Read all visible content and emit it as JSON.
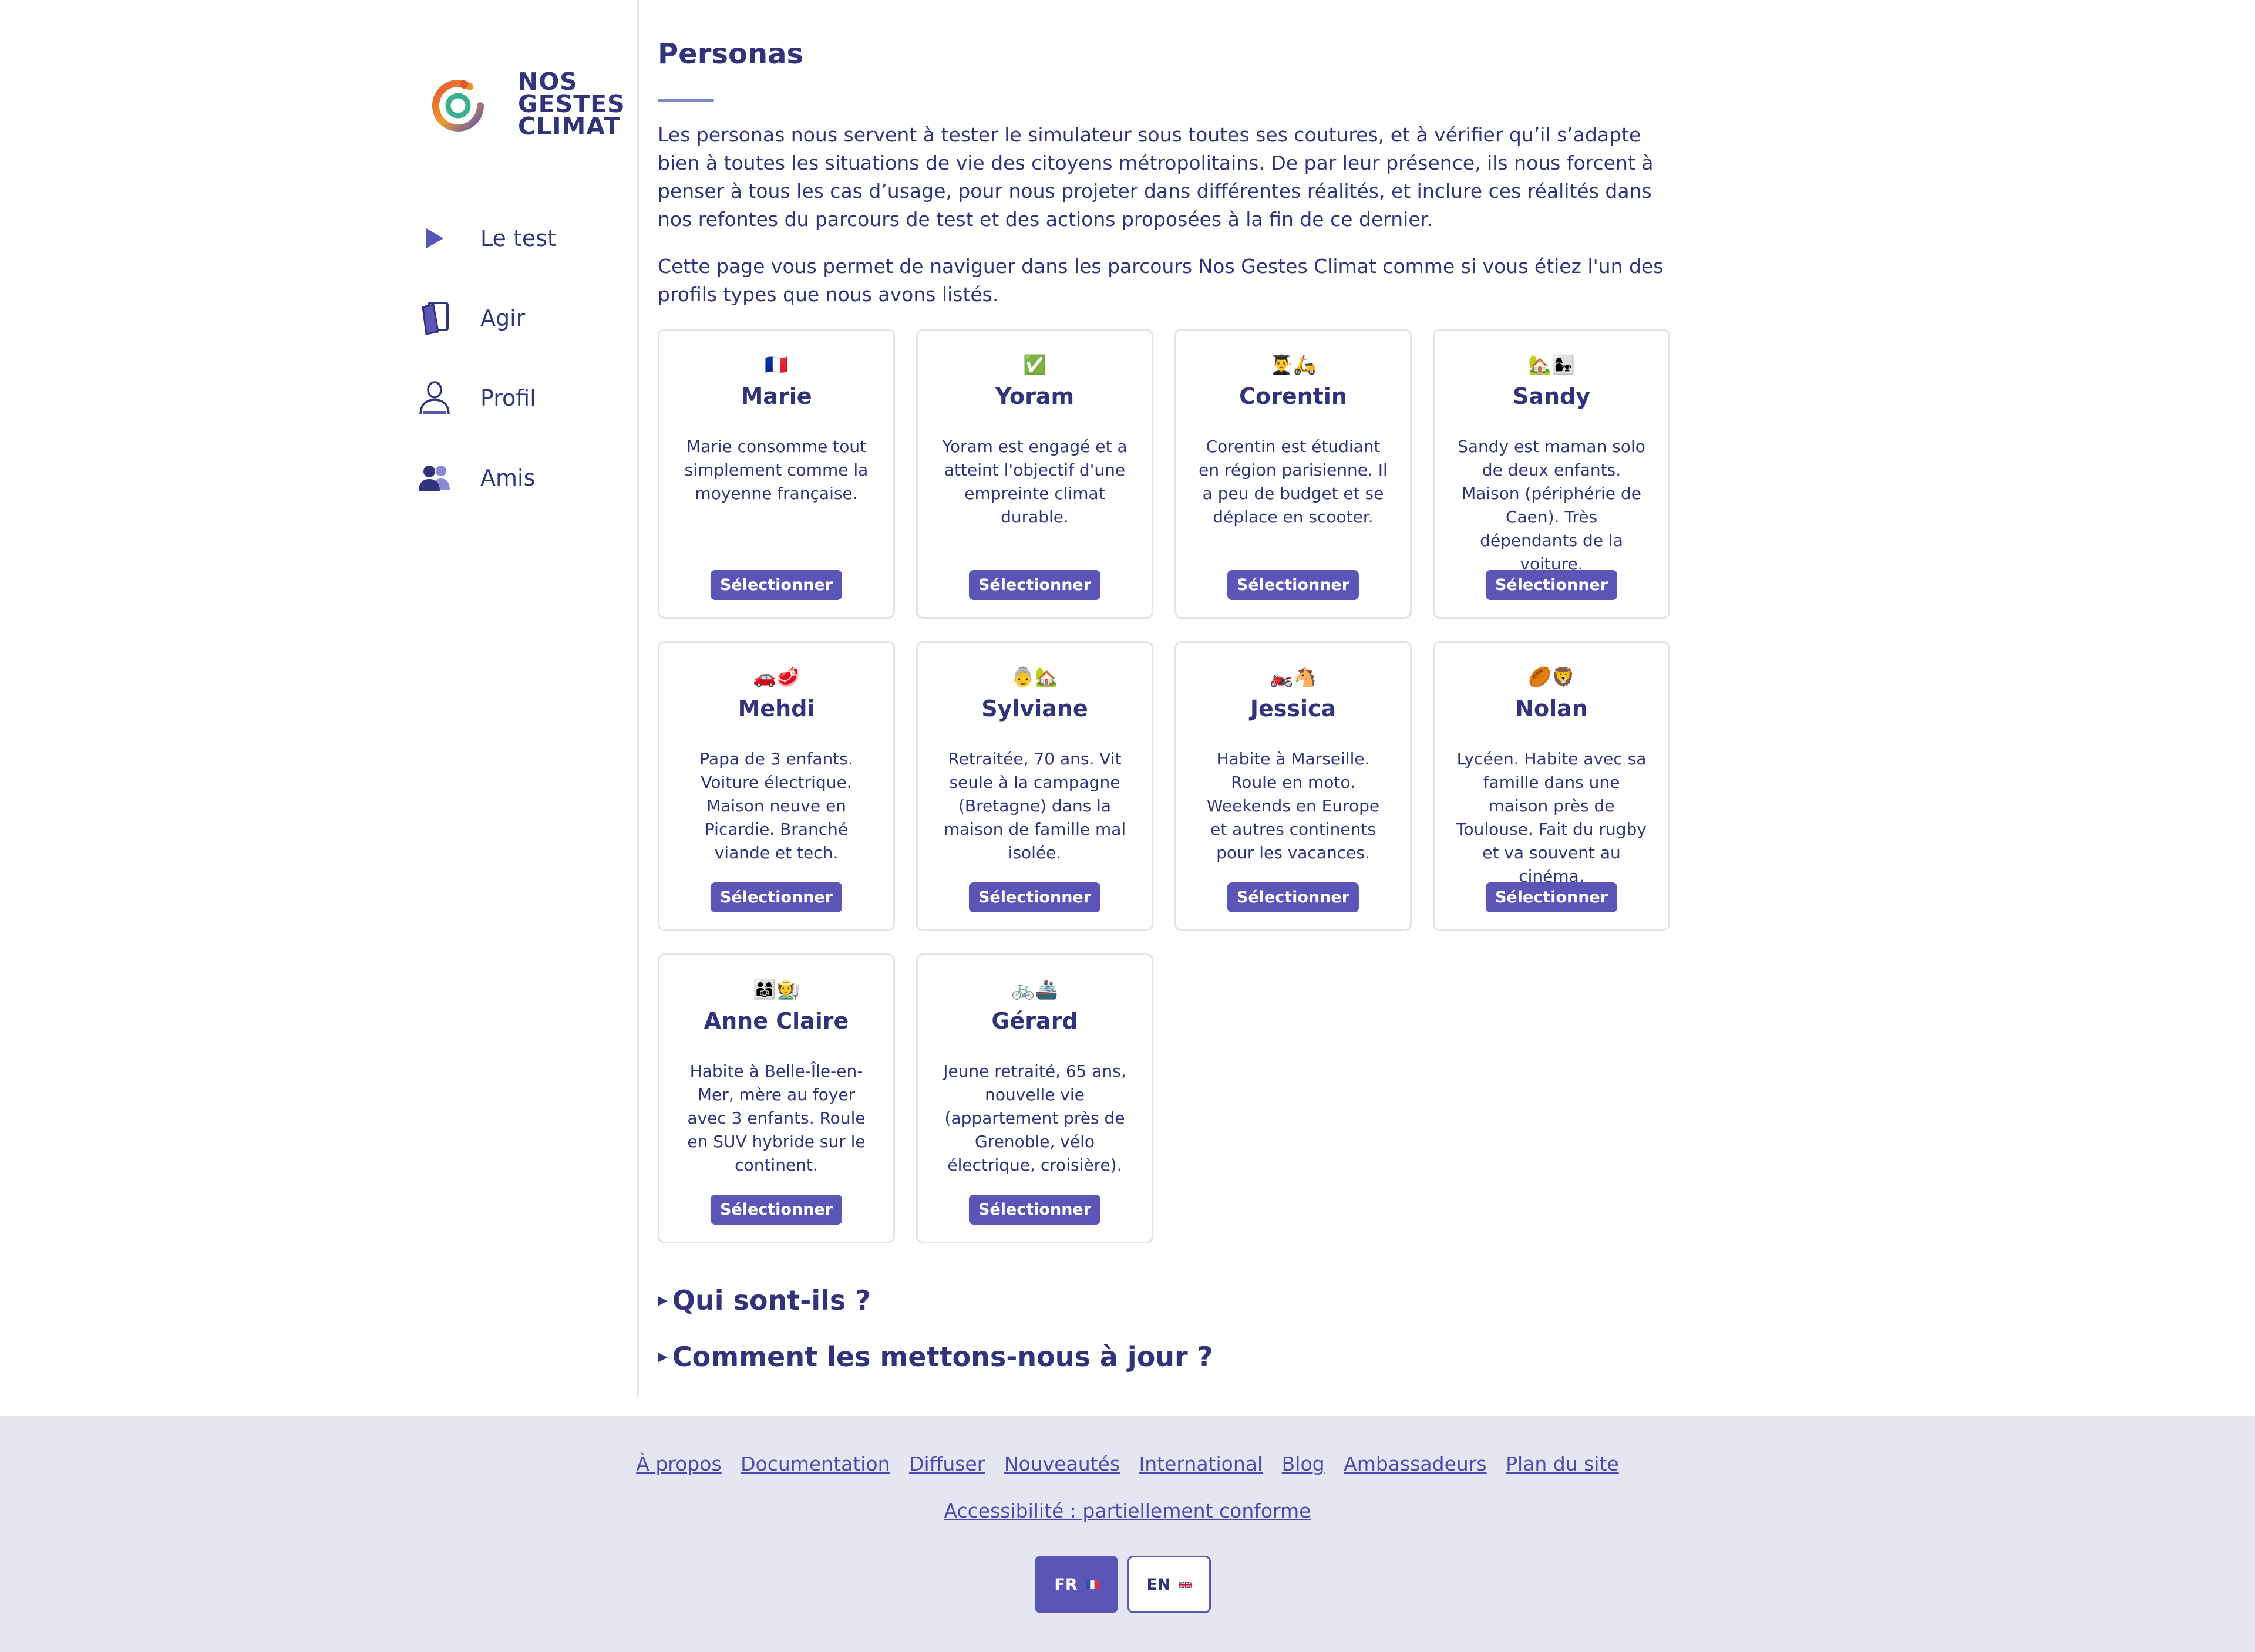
{
  "brand": {
    "logo_lines": [
      "NOS",
      "GESTES",
      "CLIMAT"
    ]
  },
  "sidebar": {
    "items": [
      {
        "label": "Le test",
        "icon": "play-icon"
      },
      {
        "label": "Agir",
        "icon": "cards-icon"
      },
      {
        "label": "Profil",
        "icon": "user-icon"
      },
      {
        "label": "Amis",
        "icon": "friends-icon"
      }
    ]
  },
  "main": {
    "title": "Personas",
    "intro_1": "Les personas nous servent à tester le simulateur sous toutes ses coutures, et à vérifier qu’il s’adapte bien à toutes les situations de vie des citoyens métropolitains. De par leur présence, ils nous forcent à penser à tous les cas d’usage, pour nous projeter dans différentes réalités, et inclure ces réalités dans nos refontes du parcours de test et des actions proposées à la fin de ce dernier.",
    "intro_2": "Cette page vous permet de naviguer dans les parcours Nos Gestes Climat comme si vous étiez l'un des profils types que nous avons listés.",
    "select_label": "Sélectionner",
    "personas": [
      {
        "emoji": "🇫🇷",
        "name": "Marie",
        "description": "Marie consomme tout simplement comme la moyenne française."
      },
      {
        "emoji": "✅",
        "name": "Yoram",
        "description": "Yoram est engagé et a atteint l'objectif d'une empreinte climat durable."
      },
      {
        "emoji": "👨‍🎓🛵",
        "name": "Corentin",
        "description": "Corentin est étudiant en région parisienne. Il a peu de budget et se déplace en scooter."
      },
      {
        "emoji": "🏡👩‍👧",
        "name": "Sandy",
        "description": "Sandy est maman solo de deux enfants. Maison (périphérie de Caen). Très dépendants de la voiture."
      },
      {
        "emoji": "🚗🥩",
        "name": "Mehdi",
        "description": "Papa de 3 enfants. Voiture électrique. Maison neuve en Picardie. Branché viande et tech."
      },
      {
        "emoji": "👵🏡",
        "name": "Sylviane",
        "description": "Retraitée, 70 ans. Vit seule à la campagne (Bretagne) dans la maison de famille mal isolée."
      },
      {
        "emoji": "🏍️🐴",
        "name": "Jessica",
        "description": "Habite à Marseille. Roule en moto. Weekends en Europe et autres continents pour les vacances."
      },
      {
        "emoji": "🏉🦁",
        "name": "Nolan",
        "description": "Lycéen. Habite avec sa famille dans une maison près de Toulouse. Fait du rugby et va souvent au cinéma."
      },
      {
        "emoji": "👨‍👩‍👧🧑‍🌾",
        "name": "Anne Claire",
        "description": "Habite à Belle-Île-en-Mer, mère au foyer avec 3 enfants. Roule en SUV hybride sur le continent."
      },
      {
        "emoji": "🚲🚢",
        "name": "Gérard",
        "description": "Jeune retraité, 65 ans, nouvelle vie (appartement près de Grenoble, vélo électrique, croisière)."
      }
    ],
    "details": [
      {
        "label": "Qui sont-ils ?"
      },
      {
        "label": "Comment les mettons-nous à jour ?"
      }
    ]
  },
  "footer": {
    "links": [
      "À propos",
      "Documentation",
      "Diffuser",
      "Nouveautés",
      "International",
      "Blog",
      "Ambassadeurs",
      "Plan du site"
    ],
    "accessibility": "Accessibilité : partiellement conforme",
    "languages": [
      {
        "code": "FR",
        "flag": "fr-flag-icon",
        "active": true
      },
      {
        "code": "EN",
        "flag": "uk-flag-icon",
        "active": false
      }
    ]
  },
  "colors": {
    "primary": "#5c55b8",
    "text": "#32337b",
    "footer_bg": "#e6e6f3"
  }
}
